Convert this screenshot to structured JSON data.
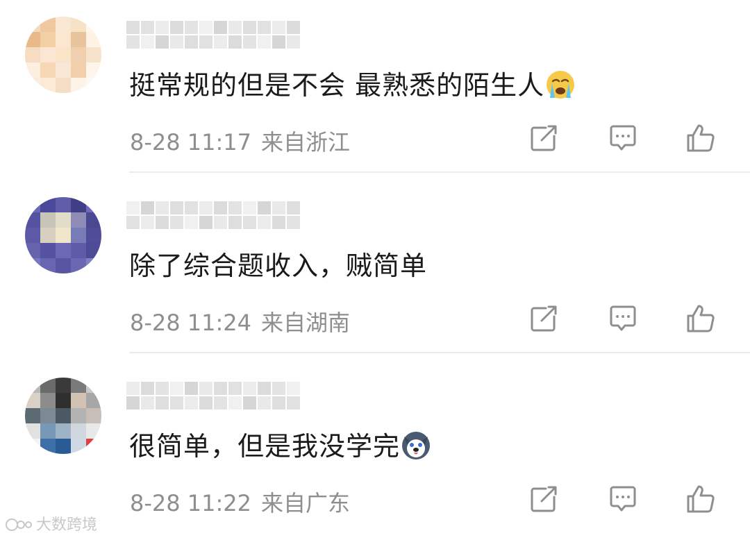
{
  "comments": [
    {
      "text": "挺常规的但是不会 最熟悉的陌生人",
      "emoji": "crying-face-emoji",
      "time": "8-28 11:17",
      "location": "来自浙江",
      "avatar_colors": [
        "#f3d9c0",
        "#f0c89f",
        "#fae7d2",
        "#f6e2c6",
        "#fff5ea",
        "#e9b98c",
        "#f2cfa5",
        "#fbe6cf",
        "#e8c49d",
        "#fdf2e4",
        "#f5dcc2",
        "#fae6d3",
        "#fbe3c8",
        "#f0cfae",
        "#f7e2cc",
        "#fcefe0",
        "#f6d8b7",
        "#f8e7d4",
        "#f1cfaa",
        "#fff4ea",
        "#f9ede0",
        "#fbead6",
        "#f5dec6",
        "#fdf3e8",
        "#fff8f1"
      ]
    },
    {
      "text": "除了综合题收入，贼简单",
      "emoji": "",
      "time": "8-28 11:24",
      "location": "来自湖南",
      "avatar_colors": [
        "#6b68b6",
        "#4b4a9a",
        "#5f5ca8",
        "#3f3e87",
        "#6f6cb7",
        "#5553a0",
        "#c9c4b8",
        "#e2ddc9",
        "#8f8cb8",
        "#4a4891",
        "#5c5aa6",
        "#d7d0c0",
        "#efe6cc",
        "#777bb8",
        "#4f4d98",
        "#6563ae",
        "#5553a1",
        "#6b69b3",
        "#5e5ca8",
        "#4d4b95",
        "#7a78bd",
        "#6866b2",
        "#5856a3",
        "#6a68b2",
        "#8380c2"
      ]
    },
    {
      "text": "很简单，但是我没学完",
      "emoji": "husky-dog-emoji",
      "time": "8-28 11:22",
      "location": "来自广东",
      "avatar_colors": [
        "#b9b9b9",
        "#6b6b6b",
        "#3a3a3a",
        "#7a7a7a",
        "#c9c9c9",
        "#d9d0c7",
        "#8c8c8c",
        "#2f2f2f",
        "#d1c2b3",
        "#a7a7a7",
        "#5c6a73",
        "#7c8a94",
        "#4c5963",
        "#b3b3b3",
        "#c7bfb7",
        "#e1e1e1",
        "#7898b8",
        "#9fb3c7",
        "#d0d7df",
        "#e8e8e8",
        "#f2f2f2",
        "#3e6fa8",
        "#2b5b95",
        "#cfd9e4",
        "#e04040"
      ]
    }
  ],
  "icons": {
    "share": "share-icon",
    "reply": "comment-icon",
    "like": "like-icon"
  },
  "watermark": {
    "text": "大数跨境"
  }
}
